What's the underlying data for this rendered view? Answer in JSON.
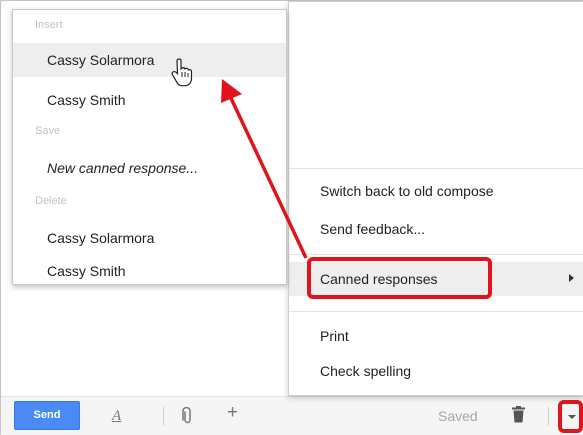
{
  "canned_menu": {
    "insert_header": "Insert",
    "insert_items": [
      "Cassy Solarmora",
      "Cassy Smith"
    ],
    "save_header": "Save",
    "save_item": "New canned response...",
    "delete_header": "Delete",
    "delete_items": [
      "Cassy Solarmora",
      "Cassy Smith"
    ]
  },
  "main_menu": {
    "switch_back": "Switch back to old compose",
    "send_feedback": "Send feedback...",
    "canned_responses": "Canned responses",
    "print": "Print",
    "check_spelling": "Check spelling"
  },
  "toolbar": {
    "send_label": "Send",
    "saved_label": "Saved"
  },
  "icons": {
    "formatting": "A",
    "attach": "paperclip",
    "more": "+",
    "trash": "trash"
  },
  "colors": {
    "send_blue": "#4a8af4",
    "annotation_red": "#e0141b"
  }
}
